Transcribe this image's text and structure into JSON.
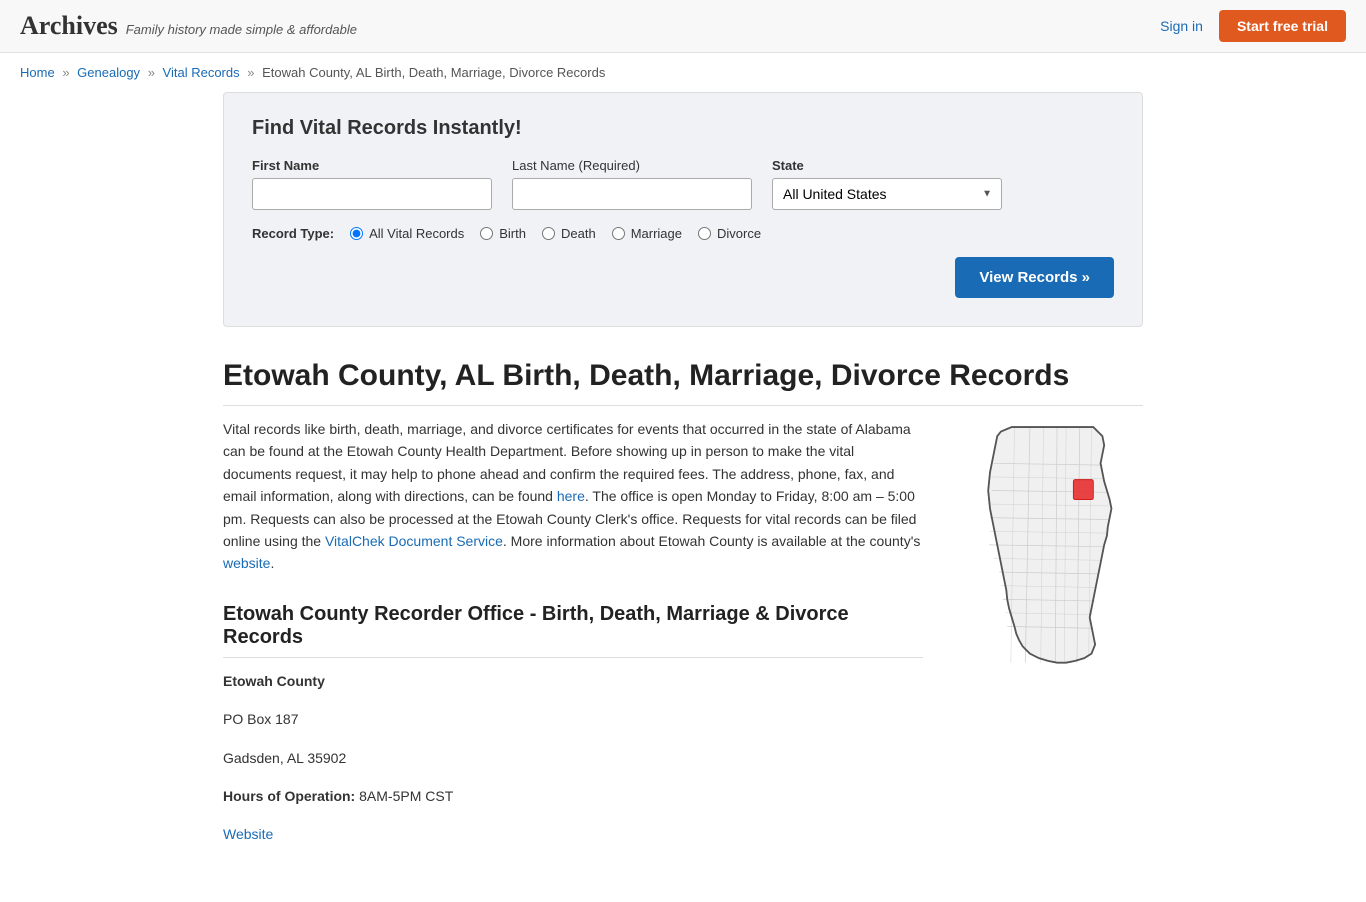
{
  "header": {
    "logo": "Archives",
    "tagline": "Family history made simple & affordable",
    "sign_in": "Sign in",
    "start_trial": "Start free trial"
  },
  "breadcrumb": {
    "items": [
      {
        "label": "Home",
        "href": "#"
      },
      {
        "label": "Genealogy",
        "href": "#"
      },
      {
        "label": "Vital Records",
        "href": "#"
      },
      {
        "label": "Etowah County, AL Birth, Death, Marriage, Divorce Records",
        "href": null
      }
    ]
  },
  "search": {
    "heading": "Find Vital Records Instantly!",
    "first_name_label": "First Name",
    "last_name_label": "Last Name",
    "last_name_required": "(Required)",
    "state_label": "State",
    "state_default": "All United States",
    "record_type_label": "Record Type:",
    "record_types": [
      {
        "id": "all",
        "label": "All Vital Records",
        "checked": true
      },
      {
        "id": "birth",
        "label": "Birth",
        "checked": false
      },
      {
        "id": "death",
        "label": "Death",
        "checked": false
      },
      {
        "id": "marriage",
        "label": "Marriage",
        "checked": false
      },
      {
        "id": "divorce",
        "label": "Divorce",
        "checked": false
      }
    ],
    "view_records_btn": "View Records »"
  },
  "page": {
    "title": "Etowah County, AL Birth, Death, Marriage, Divorce Records",
    "description": "Vital records like birth, death, marriage, and divorce certificates for events that occurred in the state of Alabama can be found at the Etowah County Health Department. Before showing up in person to make the vital documents request, it may help to phone ahead and confirm the required fees. The address, phone, fax, and email information, along with directions, can be found here. The office is open Monday to Friday, 8:00 am – 5:00 pm. Requests can also be processed at the Etowah County Clerk's office. Requests for vital records can be filed online using the VitalChek Document Service. More information about Etowah County is available at the county's website.",
    "description_parts": {
      "part1": "Vital records like birth, death, marriage, and divorce certificates for events that occurred in the state of Alabama can be found at the Etowah County Health Department. Before showing up in person to make the vital documents request, it may help to phone ahead and confirm the required fees. The address, phone, fax, and email information, along with directions, can be found ",
      "here_link": "here",
      "part2": ". The office is open Monday to Friday, 8:00 am ",
      "dash": "–",
      "part3": " 5:00 pm. Requests can also be processed at the Etowah County Clerk's office. Requests for vital records can be filed online using the ",
      "vitalchek_link": "VitalChek Document Service",
      "part4": ". More information about Etowah County is available at the county's ",
      "website_link": "website",
      "part5": "."
    },
    "recorder_heading": "Etowah County Recorder Office - Birth, Death, Marriage & Divorce Records",
    "office": {
      "name": "Etowah County",
      "address1": "PO Box 187",
      "address2": "Gadsden, AL 35902",
      "hours_label": "Hours of Operation:",
      "hours": "8AM-5PM CST",
      "website_label": "Website"
    }
  }
}
